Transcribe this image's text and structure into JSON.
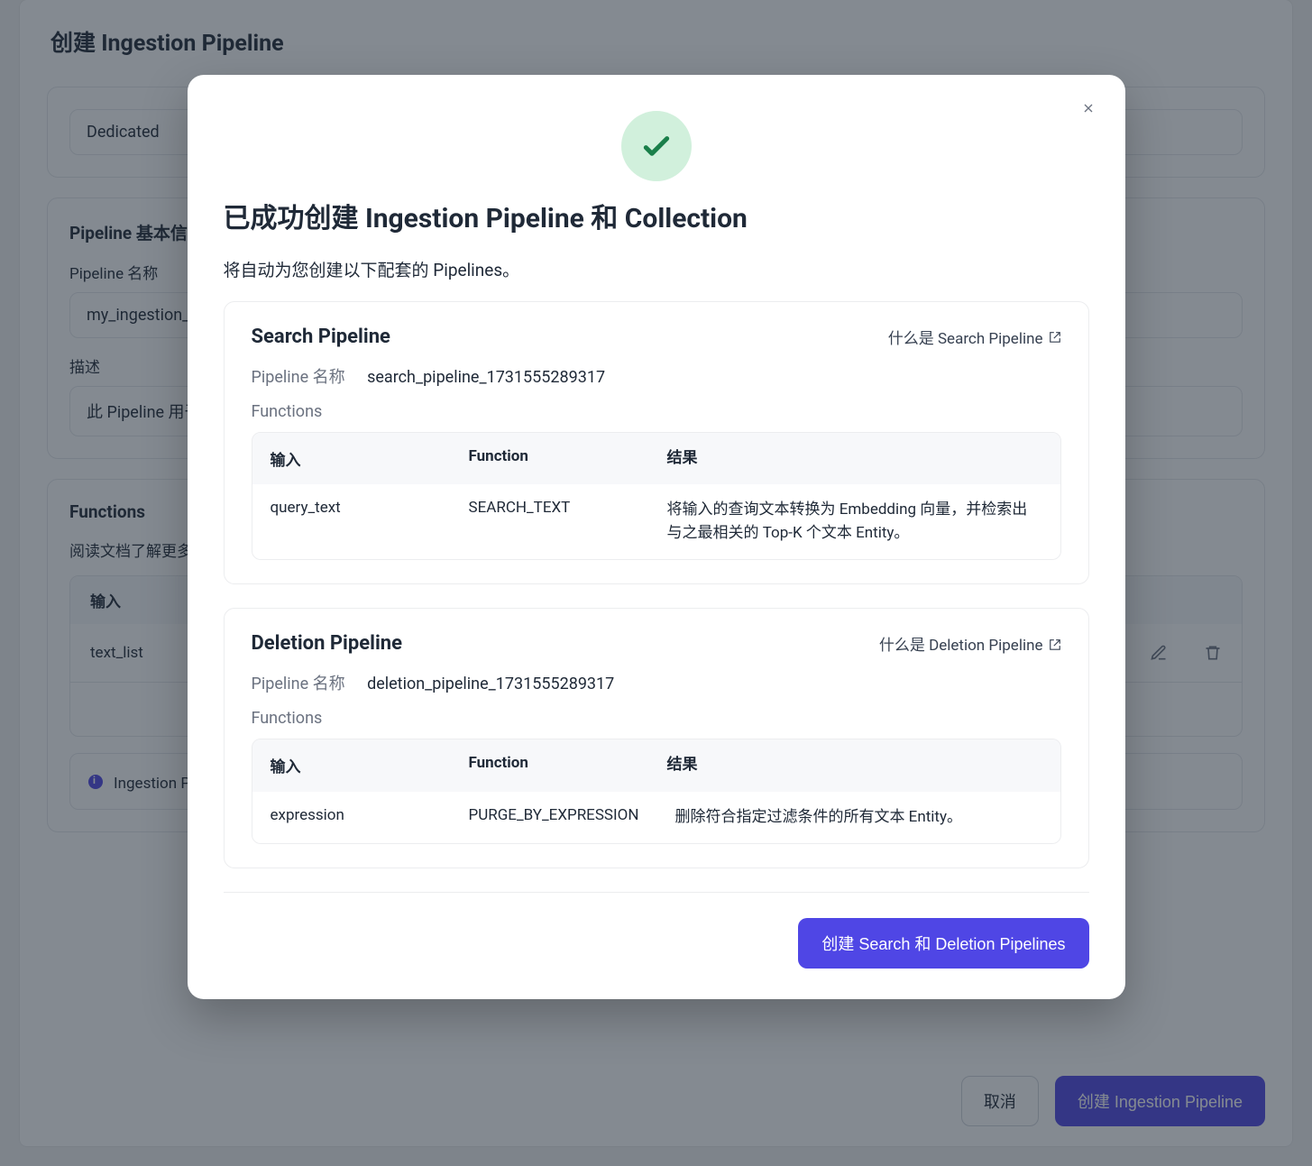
{
  "page": {
    "title": "创建 Ingestion Pipeline",
    "cluster_value": "Dedicated",
    "basics_heading": "Pipeline 基本信息",
    "name_label": "Pipeline 名称",
    "name_value": "my_ingestion_pipeline",
    "desc_label": "描述",
    "desc_value": "此 Pipeline 用于…",
    "functions_heading": "Functions",
    "functions_hint": "阅读文档了解更多。",
    "table_header_input": "输入",
    "row_input": "text_list",
    "banner_text": "Ingestion Pipeline 创建成功后，将自动生成配套的 Search 和 Deletion Pipelines。",
    "cancel": "取消",
    "submit": "创建 Ingestion Pipeline"
  },
  "modal": {
    "title": "已成功创建 Ingestion Pipeline 和 Collection",
    "subtitle": "将自动为您创建以下配套的 Pipelines。",
    "name_key": "Pipeline 名称",
    "functions_label": "Functions",
    "th_input": "输入",
    "th_func": "Function",
    "th_result": "结果",
    "search": {
      "heading": "Search Pipeline",
      "what": "什么是 Search Pipeline",
      "name": "search_pipeline_1731555289317",
      "row": {
        "input": "query_text",
        "func": "SEARCH_TEXT",
        "result": "将输入的查询文本转换为 Embedding 向量，并检索出与之最相关的 Top-K 个文本 Entity。"
      }
    },
    "deletion": {
      "heading": "Deletion Pipeline",
      "what": "什么是 Deletion Pipeline",
      "name": "deletion_pipeline_1731555289317",
      "row": {
        "input": "expression",
        "func": "PURGE_BY_EXPRESSION",
        "result": "删除符合指定过滤条件的所有文本 Entity。"
      }
    },
    "confirm": "创建 Search 和 Deletion Pipelines"
  }
}
